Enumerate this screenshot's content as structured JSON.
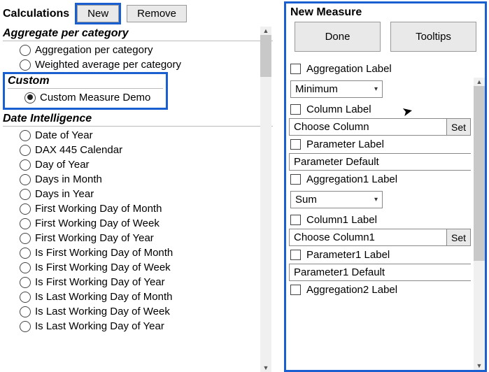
{
  "left": {
    "title": "Calculations",
    "new_label": "New",
    "remove_label": "Remove",
    "groups": {
      "aggregate": {
        "title": "Aggregate per category",
        "items": [
          {
            "label": "Aggregation per category",
            "checked": false
          },
          {
            "label": "Weighted average per category",
            "checked": false
          }
        ]
      },
      "custom": {
        "title": "Custom",
        "items": [
          {
            "label": "Custom Measure Demo",
            "checked": true
          }
        ]
      },
      "date": {
        "title": "Date Intelligence",
        "items": [
          {
            "label": "Date of Year"
          },
          {
            "label": "DAX 445 Calendar"
          },
          {
            "label": "Day of Year"
          },
          {
            "label": "Days in Month"
          },
          {
            "label": "Days in Year"
          },
          {
            "label": "First Working Day of Month"
          },
          {
            "label": "First Working Day of Week"
          },
          {
            "label": "First Working Day of Year"
          },
          {
            "label": "Is First Working Day of Month"
          },
          {
            "label": "Is First Working Day of Week"
          },
          {
            "label": "Is First Working Day of Year"
          },
          {
            "label": "Is Last Working Day of Month"
          },
          {
            "label": "Is Last Working Day of Week"
          },
          {
            "label": "Is Last Working Day of Year"
          }
        ]
      }
    }
  },
  "right": {
    "title": "New Measure",
    "done_label": "Done",
    "tooltips_label": "Tooltips",
    "agg_label": "Aggregation Label",
    "agg_select": "Minimum",
    "col_label": "Column Label",
    "choose_col": "Choose Column",
    "set_label": "Set",
    "param_label": "Parameter Label",
    "param_default": "Parameter Default",
    "agg1_label": "Aggregation1 Label",
    "agg1_select": "Sum",
    "col1_label": "Column1 Label",
    "choose_col1": "Choose Column1",
    "param1_label": "Parameter1 Label",
    "param1_default": "Parameter1 Default",
    "agg2_label": "Aggregation2 Label"
  }
}
